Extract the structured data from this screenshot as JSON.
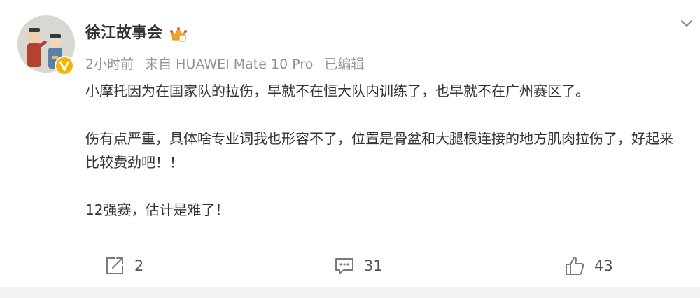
{
  "post": {
    "author": {
      "name": "徐江故事会",
      "avatar": "cartoon-avatar",
      "verified": "verified-badge",
      "vip": "vip-crown-icon"
    },
    "meta": {
      "time": "2小时前",
      "source": "来自 HUAWEI Mate 10 Pro",
      "edited": "已编辑"
    },
    "paragraphs": [
      "小摩托因为在国家队的拉伤，早就不在恒大队内训练了，也早就不在广州赛区了。",
      "伤有点严重，具体啥专业词我也形容不了，位置是骨盆和大腿根连接的地方肌肉拉伤了，好起来比较费劲吧！！",
      "12强赛，估计是难了！"
    ],
    "actions": {
      "repost": {
        "icon": "repost-icon",
        "count": "2"
      },
      "comment": {
        "icon": "comment-icon",
        "count": "31"
      },
      "like": {
        "icon": "like-icon",
        "count": "43"
      }
    }
  },
  "colors": {
    "text": "#333333",
    "meta": "#939393",
    "verified": "#f6b400",
    "vip": "#f5a623",
    "icon": "#7a7a7a"
  }
}
